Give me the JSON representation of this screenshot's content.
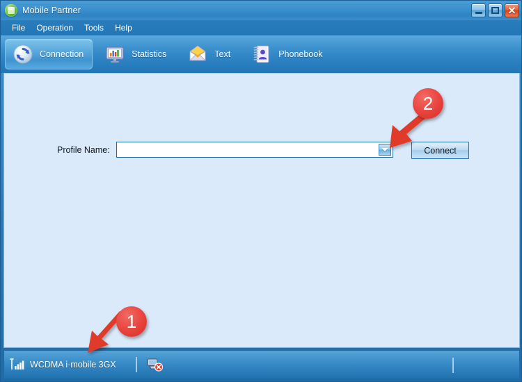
{
  "window": {
    "title": "Mobile Partner",
    "app_icon": "mobile-partner-icon",
    "buttons": {
      "minimize": "_",
      "maximize": "□",
      "close": "✕"
    }
  },
  "menubar": {
    "items": [
      {
        "label": "File"
      },
      {
        "label": "Operation"
      },
      {
        "label": "Tools"
      },
      {
        "label": "Help"
      }
    ]
  },
  "toolbar": {
    "items": [
      {
        "label": "Connection",
        "icon": "sync-circle-icon",
        "active": true
      },
      {
        "label": "Statistics",
        "icon": "monitor-chart-icon",
        "active": false
      },
      {
        "label": "Text",
        "icon": "envelope-icon",
        "active": false
      },
      {
        "label": "Phonebook",
        "icon": "notebook-contact-icon",
        "active": false
      }
    ]
  },
  "main": {
    "profile_label": "Profile Name:",
    "profile_value": "",
    "profile_placeholder": "",
    "connect_label": "Connect"
  },
  "statusbar": {
    "signal_icon": "signal-bars-icon",
    "network_text": "WCDMA  i-mobile 3GX",
    "connection_icon": "network-disconnected-icon"
  },
  "annotations": [
    {
      "number": "1",
      "target": "status-bar-network-label"
    },
    {
      "number": "2",
      "target": "profile-dropdown-arrow"
    }
  ],
  "colors": {
    "titlebar": "#3d92ce",
    "toolbar": "#2a80c0",
    "content_bg": "#daeafb",
    "statusbar": "#2a7cba",
    "accent_red": "#e8423c",
    "border_blue": "#1d6ca5"
  }
}
